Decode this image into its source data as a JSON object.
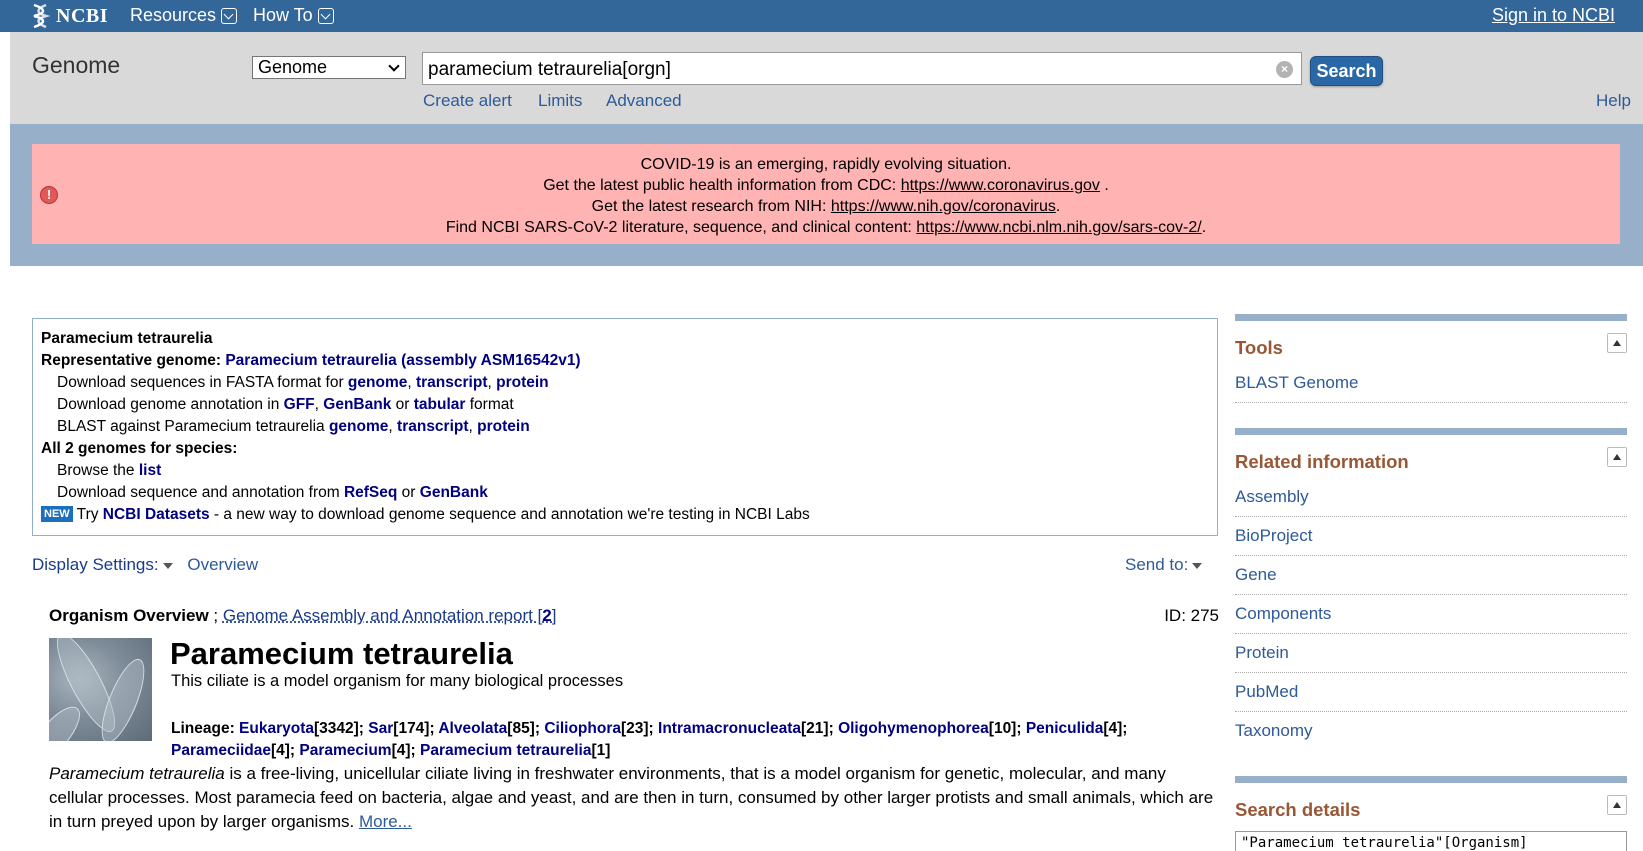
{
  "topbar": {
    "logo_text": "NCBI",
    "menus": [
      "Resources",
      "How To"
    ],
    "signin": "Sign in to NCBI"
  },
  "search": {
    "db_title": "Genome",
    "db_selected": "Genome",
    "term": "paramecium tetraurelia[orgn]",
    "button": "Search",
    "links": [
      "Create alert",
      "Limits",
      "Advanced"
    ],
    "help": "Help"
  },
  "alert": {
    "line1": "COVID-19 is an emerging, rapidly evolving situation.",
    "line2_text": "Get the latest public health information from CDC: ",
    "line2_link": "https://www.coronavirus.gov",
    "line3_text": "Get the latest research from NIH: ",
    "line3_link": "https://www.nih.gov/coronavirus",
    "line4_text": "Find NCBI SARS-CoV-2 literature, sequence, and clinical content: ",
    "line4_link": "https://www.ncbi.nlm.nih.gov/sars-cov-2/"
  },
  "genome_box": {
    "title": "Paramecium tetraurelia",
    "rep_label": "Representative genome: ",
    "rep_link": "Paramecium tetraurelia (assembly ASM16542v1)",
    "dl_fasta_text": "Download sequences in FASTA format for ",
    "dl_annot_text": "Download genome annotation in ",
    "dl_annot_or": " or ",
    "dl_annot_format": " format",
    "blast_text": "BLAST against Paramecium tetraurelia ",
    "seq_types": [
      "genome",
      "transcript",
      "protein"
    ],
    "annot_formats": [
      "GFF",
      "GenBank",
      "tabular"
    ],
    "all_label": "All 2 genomes for species:",
    "browse_text": "Browse the ",
    "browse_link": "list",
    "dl_seq_text": "Download sequence and annotation from ",
    "dl_seq_links": [
      "RefSeq",
      "GenBank"
    ],
    "new_badge": "NEW",
    "try_text": "Try ",
    "datasets_link": "NCBI Datasets",
    "datasets_tail": " - a new way to download genome sequence and annotation we're testing in NCBI Labs"
  },
  "display": {
    "settings": "Display Settings:",
    "overview": "Overview",
    "send_to": "Send to:"
  },
  "organism": {
    "overview_label": "Organism Overview",
    "report_link": "Genome Assembly and Annotation report [",
    "report_count": "2",
    "report_close": "]",
    "id_text": "ID: 275",
    "name": "Paramecium tetraurelia",
    "tagline": "This ciliate is a model organism for many biological processes",
    "lineage_label": "Lineage: ",
    "lineage": [
      {
        "name": "Eukaryota",
        "count": "3342"
      },
      {
        "name": "Sar",
        "count": "174"
      },
      {
        "name": "Alveolata",
        "count": "85"
      },
      {
        "name": "Ciliophora",
        "count": "23"
      },
      {
        "name": "Intramacronucleata",
        "count": "21"
      },
      {
        "name": "Oligohymenophorea",
        "count": "10"
      },
      {
        "name": "Peniculida",
        "count": "4"
      },
      {
        "name": "Parameciidae",
        "count": "4"
      },
      {
        "name": "Paramecium",
        "count": "4"
      },
      {
        "name": "Paramecium tetraurelia",
        "count": "1"
      }
    ],
    "desc_italic": "Paramecium tetraurelia",
    "desc_text": " is a free-living, unicellular ciliate living in freshwater environments, that is a model organism for genetic, molecular, and many cellular processes. Most paramecia feed on bacteria, algae and yeast, and are then in turn, consumed by other larger protists and small animals, which are in turn preyed upon by larger organisms. ",
    "more_link": "More..."
  },
  "sidebar": {
    "tools_title": "Tools",
    "tools_items": [
      "BLAST Genome"
    ],
    "related_title": "Related information",
    "related_items": [
      "Assembly",
      "BioProject",
      "Gene",
      "Components",
      "Protein",
      "PubMed",
      "Taxonomy"
    ],
    "details_title": "Search details",
    "details_query": "\"Paramecium tetraurelia\"[Organism]"
  }
}
